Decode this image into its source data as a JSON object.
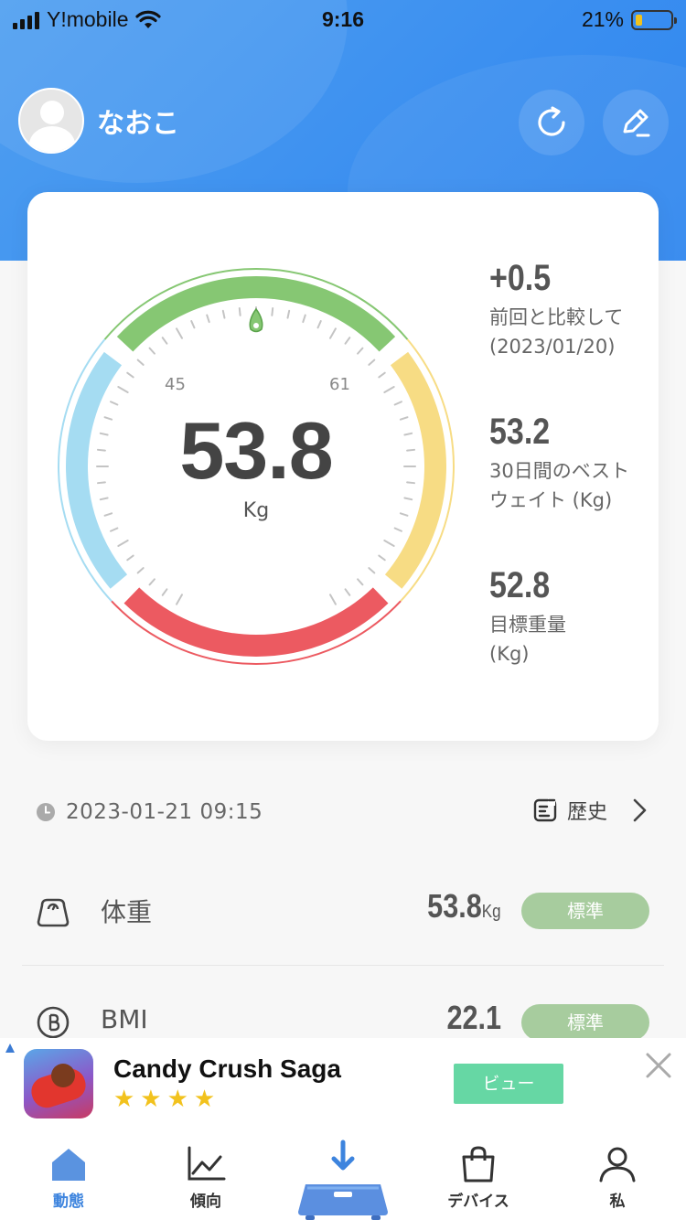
{
  "status_bar": {
    "carrier": "Y!mobile",
    "time": "9:16",
    "battery_percent": "21%"
  },
  "profile": {
    "name": "なおこ"
  },
  "gauge": {
    "weight": "53.8",
    "unit": "Kg",
    "range_low": "45",
    "range_high": "61"
  },
  "stats": [
    {
      "value": "+0.5",
      "desc_line1": "前回と比較して",
      "desc_line2": "(2023/01/20)"
    },
    {
      "value": "53.2",
      "desc_line1": "30日間のベスト",
      "desc_line2": "ウェイト (Kg)"
    },
    {
      "value": "52.8",
      "desc_line1": "目標重量",
      "desc_line2": "(Kg)"
    }
  ],
  "measurement": {
    "timestamp": "2023-01-21 09:15",
    "history_label": "歴史"
  },
  "metrics": [
    {
      "name": "体重",
      "value": "53.8",
      "unit": "Kg",
      "status": "標準"
    },
    {
      "name": "BMI",
      "value": "22.1",
      "unit": "",
      "status": "標準"
    }
  ],
  "ad": {
    "title": "Candy Crush Saga",
    "stars": "★★★★",
    "button_label": "ビュー"
  },
  "tabs": [
    {
      "label": "動態"
    },
    {
      "label": "傾向"
    },
    {
      "label": "デバイス"
    },
    {
      "label": "私"
    }
  ],
  "colors": {
    "header_blue": "#3b8ff0",
    "accent_blue": "#3d84de",
    "zone_blue": "#a5dcf2",
    "zone_green": "#86c773",
    "zone_yellow": "#f7dc84",
    "zone_red": "#ec5a61",
    "badge_green": "#a7cc9e"
  }
}
